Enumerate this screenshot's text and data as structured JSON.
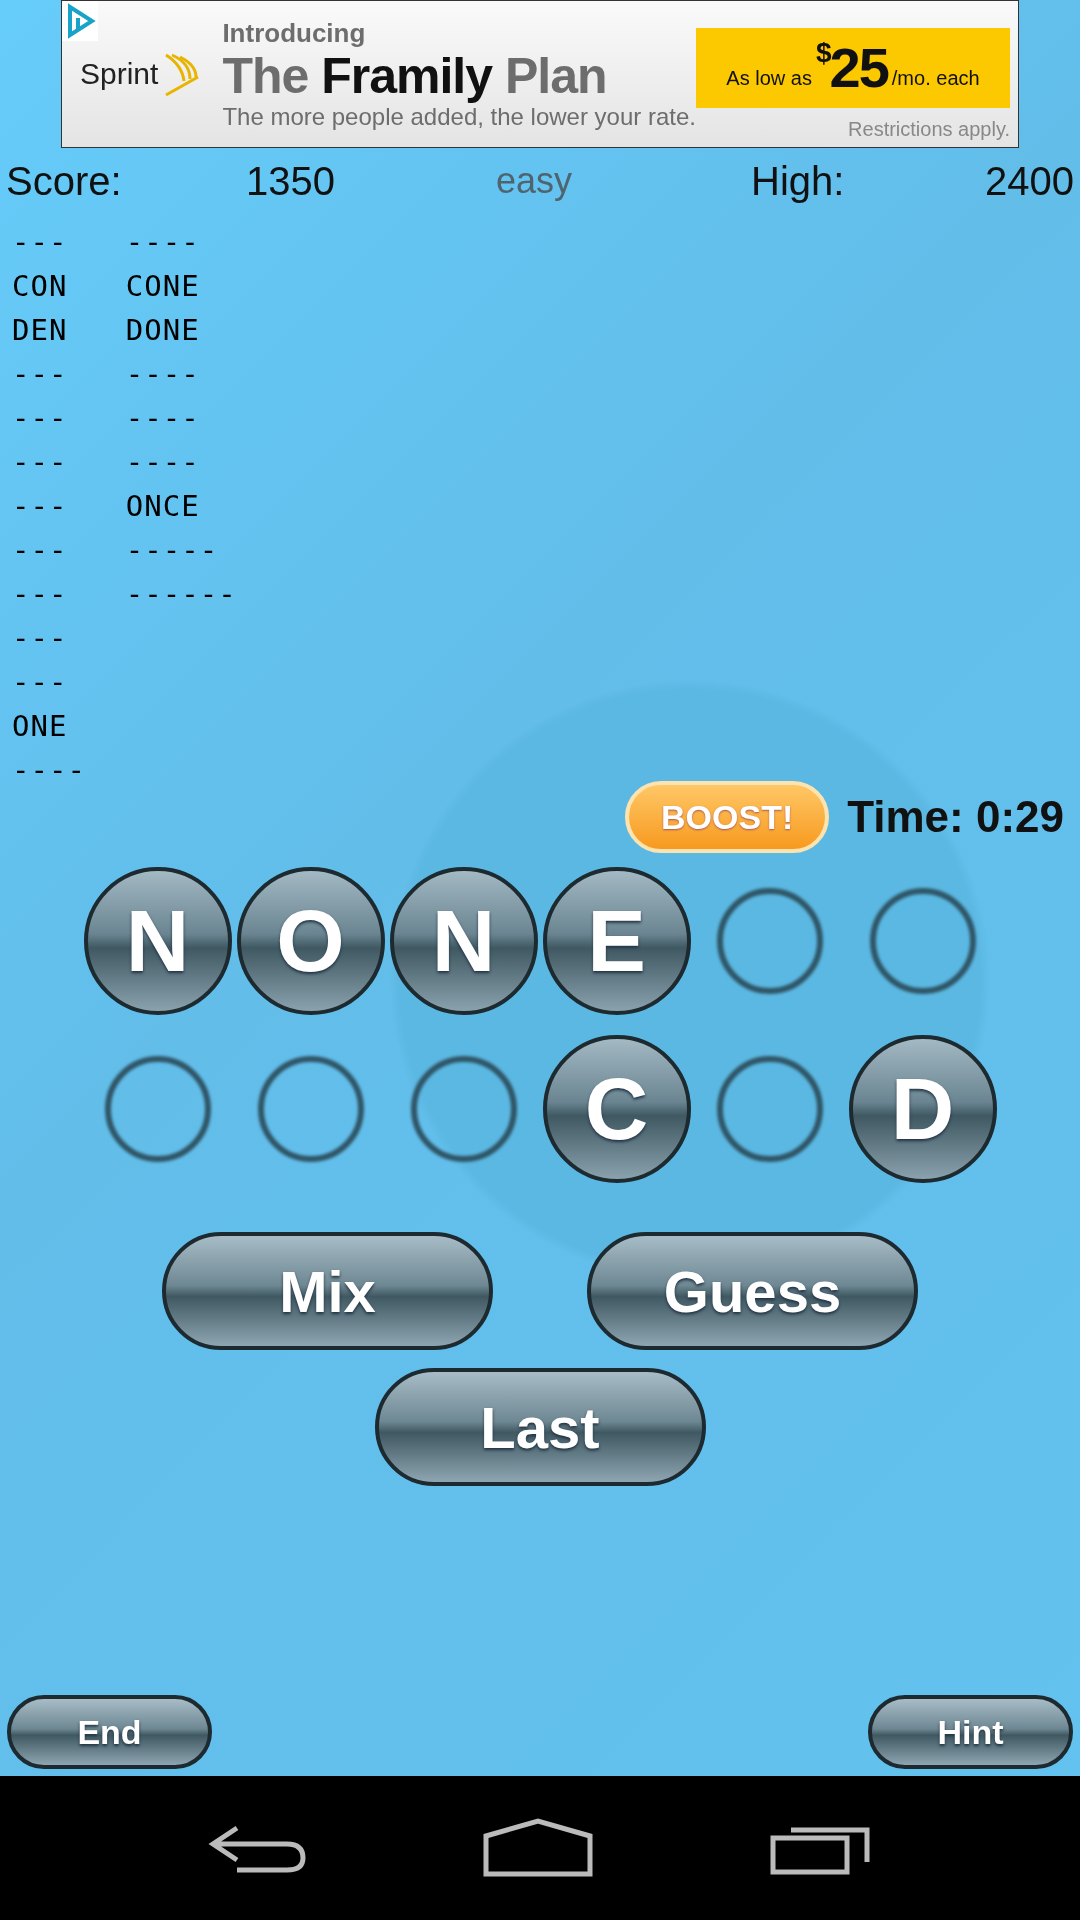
{
  "ad": {
    "brand": "Sprint",
    "intro": "Introducing",
    "headline": [
      {
        "text": "The ",
        "kind": "grey"
      },
      {
        "text": "Framily",
        "kind": "dark"
      },
      {
        "text": " Plan",
        "kind": "grey"
      }
    ],
    "tagline": "The more people added, the lower your rate.",
    "offer_prefix": "As low as",
    "offer_currency": "$",
    "offer_amount": "25",
    "offer_suffix": "/mo. each",
    "disclaimer": "Restrictions apply."
  },
  "header": {
    "score_label": "Score:",
    "score": "1350",
    "difficulty": "easy",
    "high_label": "High:",
    "high": "2400"
  },
  "word_columns": [
    [
      "---",
      "CON",
      "DEN",
      "---",
      "---",
      "---",
      "---",
      "---",
      "---",
      "---",
      "---",
      "ONE",
      "----"
    ],
    [
      "----",
      "CONE",
      "DONE",
      "----",
      "----",
      "----",
      "ONCE",
      "-----",
      "------"
    ]
  ],
  "boost": "BOOST!",
  "time": "Time: 0:29",
  "slot_rows": [
    [
      {
        "kind": "tile",
        "letter": "N"
      },
      {
        "kind": "tile",
        "letter": "O"
      },
      {
        "kind": "tile",
        "letter": "N"
      },
      {
        "kind": "tile",
        "letter": "E"
      },
      {
        "kind": "empty"
      },
      {
        "kind": "empty"
      }
    ],
    [
      {
        "kind": "empty"
      },
      {
        "kind": "empty"
      },
      {
        "kind": "empty"
      },
      {
        "kind": "tile",
        "letter": "C"
      },
      {
        "kind": "empty"
      },
      {
        "kind": "tile",
        "letter": "D"
      }
    ]
  ],
  "actions": [
    "Mix",
    "Guess"
  ],
  "last": "Last",
  "footer": {
    "left": "End",
    "right": "Hint"
  }
}
